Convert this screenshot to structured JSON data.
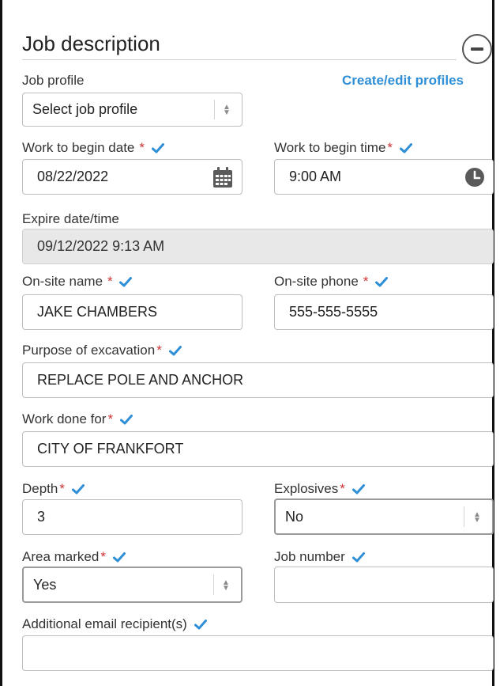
{
  "section": {
    "title": "Job description"
  },
  "job_profile": {
    "label": "Job profile",
    "link": "Create/edit profiles",
    "value": "Select job profile"
  },
  "work_begin_date": {
    "label": "Work to begin date",
    "required": "*",
    "value": "08/22/2022"
  },
  "work_begin_time": {
    "label": "Work to begin time",
    "required": "*",
    "value": "9:00 AM"
  },
  "expire": {
    "label": "Expire date/time",
    "value": "09/12/2022 9:13 AM"
  },
  "onsite_name": {
    "label": "On-site name",
    "required": "*",
    "value": "JAKE CHAMBERS"
  },
  "onsite_phone": {
    "label": "On-site phone",
    "required": "*",
    "value": "555-555-5555"
  },
  "purpose": {
    "label": "Purpose of excavation",
    "required": "*",
    "value": "REPLACE POLE AND ANCHOR"
  },
  "work_done_for": {
    "label": "Work done for",
    "required": "*",
    "value": "CITY OF FRANKFORT"
  },
  "depth": {
    "label": "Depth",
    "required": "*",
    "value": "3"
  },
  "explosives": {
    "label": "Explosives",
    "required": "*",
    "value": "No"
  },
  "area_marked": {
    "label": "Area marked",
    "required": "*",
    "value": "Yes"
  },
  "job_number": {
    "label": "Job number",
    "value": ""
  },
  "additional_email": {
    "label": "Additional email recipient(s)",
    "value": ""
  },
  "icons": {
    "check": "check-icon",
    "calendar": "calendar-icon",
    "clock": "clock-icon",
    "collapse": "minus-circle-icon",
    "select": "select-arrows-icon"
  },
  "colors": {
    "accent": "#2f8fd6",
    "required": "#d03333",
    "disabled_bg": "#e8e8e8"
  }
}
